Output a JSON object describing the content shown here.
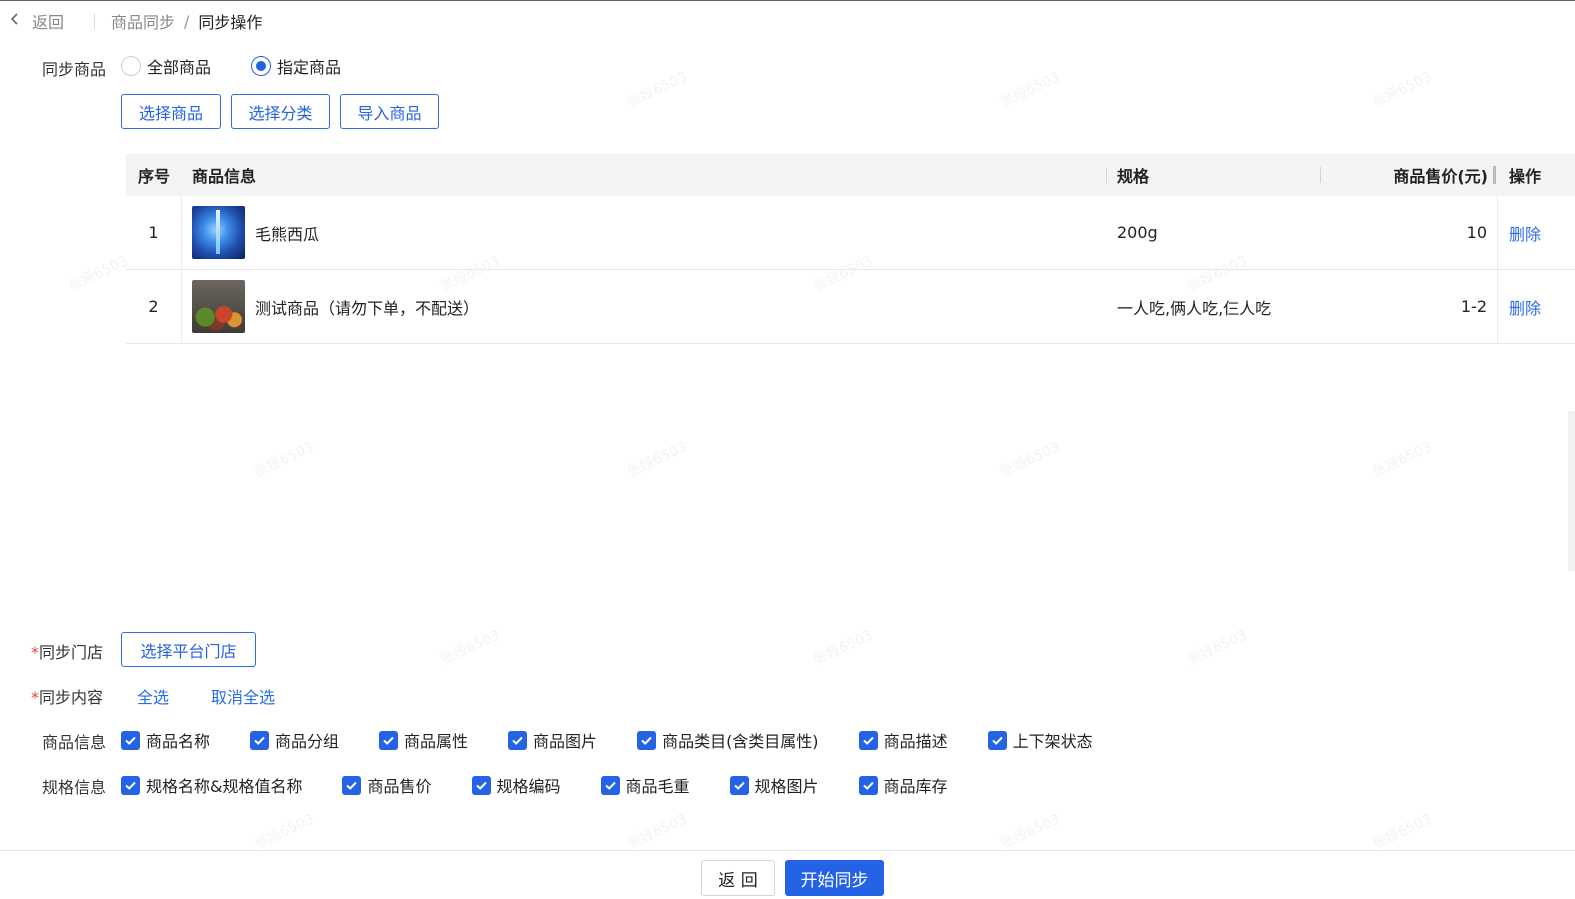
{
  "breadcrumb": {
    "back_label": "返回",
    "parent": "商品同步",
    "separator": "/",
    "current": "同步操作"
  },
  "sync_goods": {
    "label": "同步商品",
    "options": [
      {
        "label": "全部商品",
        "checked": false
      },
      {
        "label": "指定商品",
        "checked": true
      }
    ],
    "buttons": {
      "select_goods": "选择商品",
      "select_category": "选择分类",
      "import_goods": "导入商品"
    }
  },
  "table": {
    "headers": {
      "index": "序号",
      "info": "商品信息",
      "spec": "规格",
      "price": "商品售价(元)",
      "op": "操作"
    },
    "rows": [
      {
        "index": "1",
        "name": "毛熊西瓜",
        "spec": "200g",
        "price": "10",
        "op": "删除"
      },
      {
        "index": "2",
        "name": "测试商品（请勿下单，不配送）",
        "spec": "一人吃,俩人吃,仨人吃",
        "price": "1-2",
        "op": "删除"
      }
    ]
  },
  "sync_store": {
    "required_mark": "*",
    "label": "同步门店",
    "button": "选择平台门店"
  },
  "sync_content": {
    "required_mark": "*",
    "label": "同步内容",
    "select_all": "全选",
    "deselect_all": "取消全选"
  },
  "goods_info": {
    "label": "商品信息",
    "options": [
      "商品名称",
      "商品分组",
      "商品属性",
      "商品图片",
      "商品类目(含类目属性)",
      "商品描述",
      "上下架状态"
    ]
  },
  "spec_info": {
    "label": "规格信息",
    "options": [
      "规格名称&规格值名称",
      "商品售价",
      "规格编码",
      "商品毛重",
      "规格图片",
      "商品库存"
    ]
  },
  "footer": {
    "back": "返 回",
    "start": "开始同步"
  },
  "colors": {
    "primary": "#2462e6",
    "required": "#e5484d"
  },
  "watermark": "张娅6503"
}
